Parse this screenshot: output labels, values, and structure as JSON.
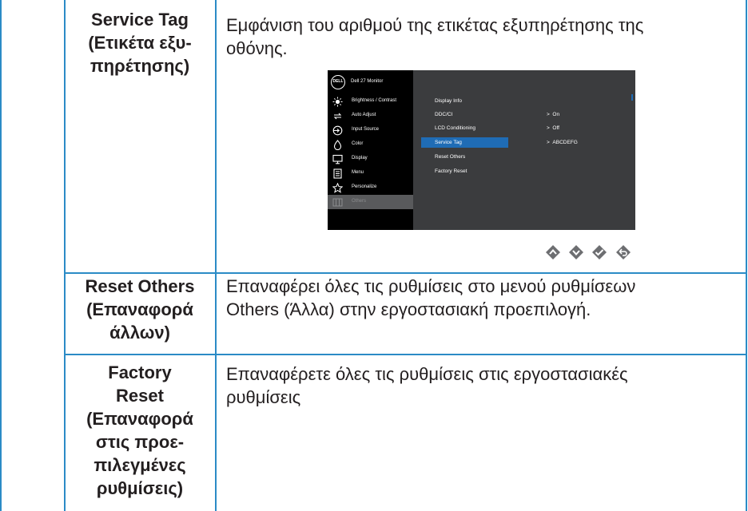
{
  "rows": [
    {
      "term_lines": [
        "Service Tag",
        "(Ετικέτα εξυ-",
        "πηρέτησης)"
      ],
      "desc_lines": [
        "Εμφάνιση του αριθμού της ετικέτας εξυπηρέτησης της",
        "οθόνης."
      ]
    },
    {
      "term_lines": [
        "Reset Others",
        "(Επαναφορά",
        "άλλων)"
      ],
      "desc_lines": [
        "Επαναφέρει όλες τις ρυθμίσεις στο μενού ρυθμίσεων",
        "Others (Άλλα) στην εργοστασιακή προεπιλογή."
      ]
    },
    {
      "term_lines": [
        "Factory",
        "Reset",
        "(Επαναφορά",
        "στις προε-",
        "πιλεγμένες",
        "ρυθμίσεις)"
      ],
      "desc_lines": [
        "Επαναφέρετε όλες τις ρυθμίσεις στις εργοστασιακές",
        "ρυθμίσεις"
      ]
    }
  ],
  "osd": {
    "logo": "DELL",
    "title": "Dell 27 Monitor",
    "menu": [
      {
        "label": "Brightness / Contrast",
        "icon": "brightness-icon"
      },
      {
        "label": "Auto Adjust",
        "icon": "auto-adjust-icon"
      },
      {
        "label": "Input Source",
        "icon": "input-source-icon"
      },
      {
        "label": "Color",
        "icon": "color-icon"
      },
      {
        "label": "Display",
        "icon": "display-icon"
      },
      {
        "label": "Menu",
        "icon": "menu-icon"
      },
      {
        "label": "Personalize",
        "icon": "star-icon"
      },
      {
        "label": "Others",
        "icon": "others-icon"
      }
    ],
    "submenu": [
      "Display Info",
      "DDC/CI",
      "LCD Conditioning",
      "Service Tag",
      "Reset Others",
      "Factory Reset"
    ],
    "values": [
      "On",
      "Off",
      "ABCDEFG"
    ],
    "value_prefix": ">",
    "highlight_color": "#1f6cb5"
  },
  "nav_buttons": [
    "up-icon",
    "down-icon",
    "check-icon",
    "back-icon"
  ],
  "colors": {
    "border": "#2b8bc6",
    "text": "#231f20",
    "nav": "#6d6e71"
  }
}
